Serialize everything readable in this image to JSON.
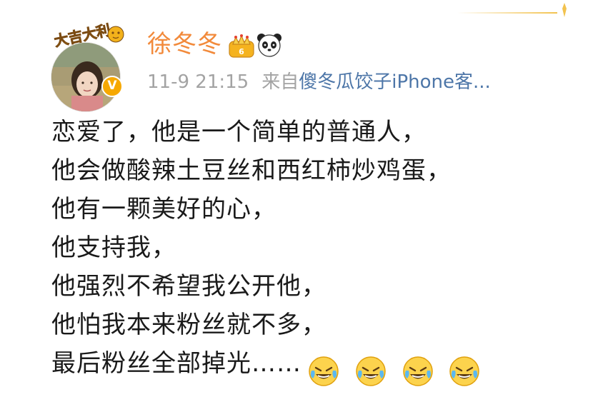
{
  "user": {
    "name": "徐冬冬",
    "avatar_caption": "大吉大利"
  },
  "meta": {
    "time": "11-9 21:15",
    "source_prefix": "来自",
    "source_name": "傻冬瓜饺子iPhone客..."
  },
  "post": {
    "lines": [
      "恋爱了，他是一个简单的普通人，",
      "他会做酸辣土豆丝和西红柿炒鸡蛋，",
      "他有一颗美好的心，",
      "他支持我，",
      "他强烈不希望我公开他，",
      "他怕我本来粉丝就不多，",
      "最后粉丝全部掉光……"
    ],
    "emojis": [
      "laugh-cry-emoji",
      "laugh-cry-emoji",
      "laugh-cry-emoji",
      "laugh-cry-emoji"
    ]
  },
  "colors": {
    "username": "#f28a3b",
    "meta_gray": "#a3a3a3",
    "source_link": "#4d76a8",
    "verified": "#f6a800",
    "text": "#1a1a1a"
  },
  "icons": {
    "crown": "vip-crown-icon",
    "panda": "panda-icon",
    "verified": "verified-badge-icon"
  }
}
